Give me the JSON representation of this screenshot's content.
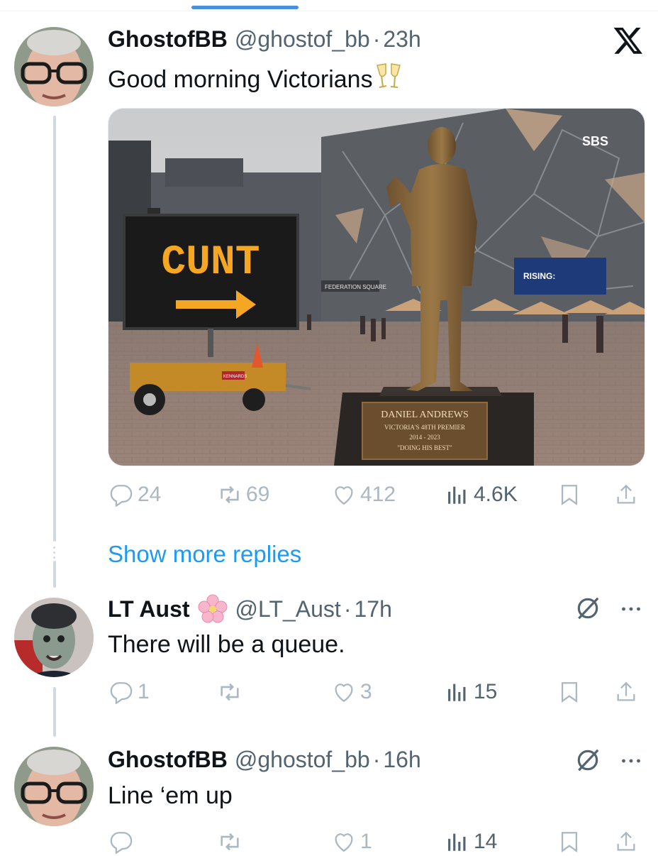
{
  "tweet": {
    "display_name": "GhostofBB",
    "handle": "@ghostof_bb",
    "separator": "·",
    "time": "23h",
    "text": "Good morning Victorians",
    "emoji_icon": "clinking-glasses-icon",
    "media": {
      "sign_text": "CUNT",
      "plaza_sign": "FEDERATION SQUARE",
      "broadcaster_sign": "SBS",
      "banner_text": "RISING:",
      "trailer_plate": "KENNARDS",
      "plaque": {
        "line1": "DANIEL ANDREWS",
        "line2": "VICTORIA'S 48TH PREMIER",
        "line3": "2014 - 2023",
        "line4": "\"DOING HIS BEST\""
      }
    },
    "stats": {
      "replies": "24",
      "reposts": "69",
      "likes": "412",
      "views": "4.6K"
    }
  },
  "show_more_replies": "Show more replies",
  "replies": [
    {
      "display_name": "LT Aust",
      "badge_icon": "cherry-blossom-icon",
      "handle": "@LT_Aust",
      "separator": "·",
      "time": "17h",
      "text": "There will be a queue.",
      "stats": {
        "replies": "1",
        "reposts": "",
        "likes": "3",
        "views": "15"
      }
    },
    {
      "display_name": "GhostofBB",
      "handle": "@ghostof_bb",
      "separator": "·",
      "time": "16h",
      "text": "Line ‘em up",
      "stats": {
        "replies": "",
        "reposts": "",
        "likes": "1",
        "views": "14"
      }
    }
  ],
  "colors": {
    "link": "#1d9bf0",
    "muted": "#536471",
    "faint": "#aab8c2",
    "thread": "#cfd9de"
  }
}
